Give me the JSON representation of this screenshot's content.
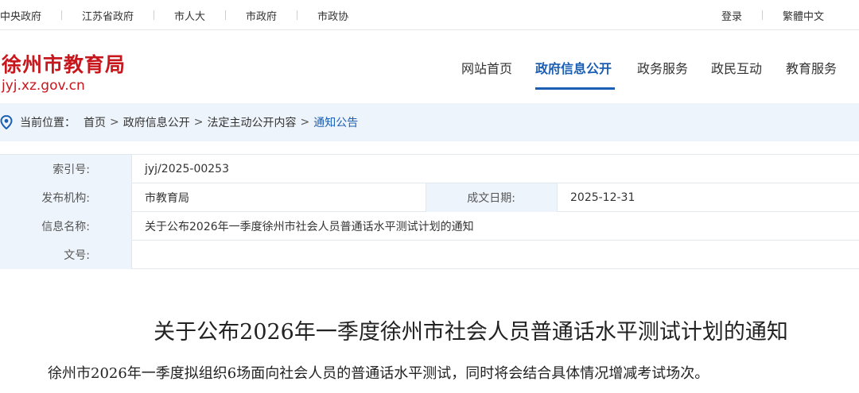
{
  "topbar": {
    "links": [
      "中央政府",
      "江苏省政府",
      "市人大",
      "市政府",
      "市政协"
    ],
    "login": "登录",
    "traditional": "繁體中文"
  },
  "header": {
    "site_title": "徐州市教育局",
    "domain": "jyj.xz.gov.cn",
    "nav": [
      "网站首页",
      "政府信息公开",
      "政务服务",
      "政民互动",
      "教育服务"
    ],
    "nav_active": "政府信息公开"
  },
  "breadcrumb": {
    "label": "当前位置：",
    "items": [
      "首页",
      "政府信息公开",
      "法定主动公开内容",
      "通知公告"
    ],
    "separator": ">"
  },
  "info": {
    "index_label": "索引号:",
    "index_value": "jyj/2025-00253",
    "publisher_label": "发布机构:",
    "publisher_value": "市教育局",
    "date_label": "成文日期:",
    "date_value": "2025-12-31",
    "name_label": "信息名称:",
    "name_value": "关于公布2026年一季度徐州市社会人员普通话水平测试计划的通知",
    "docno_label": "文号:",
    "docno_value": ""
  },
  "article": {
    "title": "关于公布2026年一季度徐州市社会人员普通话水平测试计划的通知",
    "body": "徐州市2026年一季度拟组织6场面向社会人员的普通话水平测试，同时将会结合具体情况增减考试场次。"
  },
  "colors": {
    "brand_red": "#c8161d",
    "accent_blue": "#1a5fb4",
    "panel_bg": "#eef4fb"
  }
}
